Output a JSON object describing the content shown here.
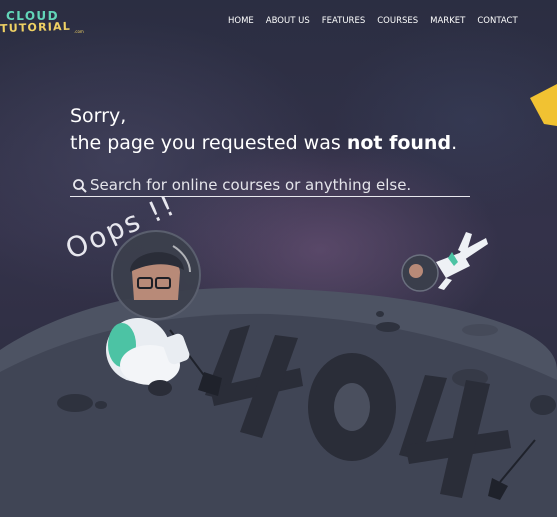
{
  "brand": {
    "line1": "CLOUD",
    "line2": "TUTORIAL",
    "suffix": ".com",
    "colors": {
      "cloud": "#62d6b8",
      "tutorial": "#f0d264"
    }
  },
  "nav": {
    "items": [
      "HOME",
      "ABOUT US",
      "FEATURES",
      "COURSES",
      "MARKET",
      "CONTACT"
    ]
  },
  "message": {
    "line1": "Sorry,",
    "line2_prefix": "the page you requested was ",
    "line2_bold": "not found",
    "line2_suffix": "."
  },
  "search": {
    "placeholder": "Search for online courses or anything else.",
    "value": "",
    "icon": "search-icon"
  },
  "illustration": {
    "exclamation": "Oops !!",
    "error_code": "404",
    "colors": {
      "asteroid": "#4d5363",
      "sky": "#2b2e42",
      "accent": "#f1c232"
    }
  }
}
